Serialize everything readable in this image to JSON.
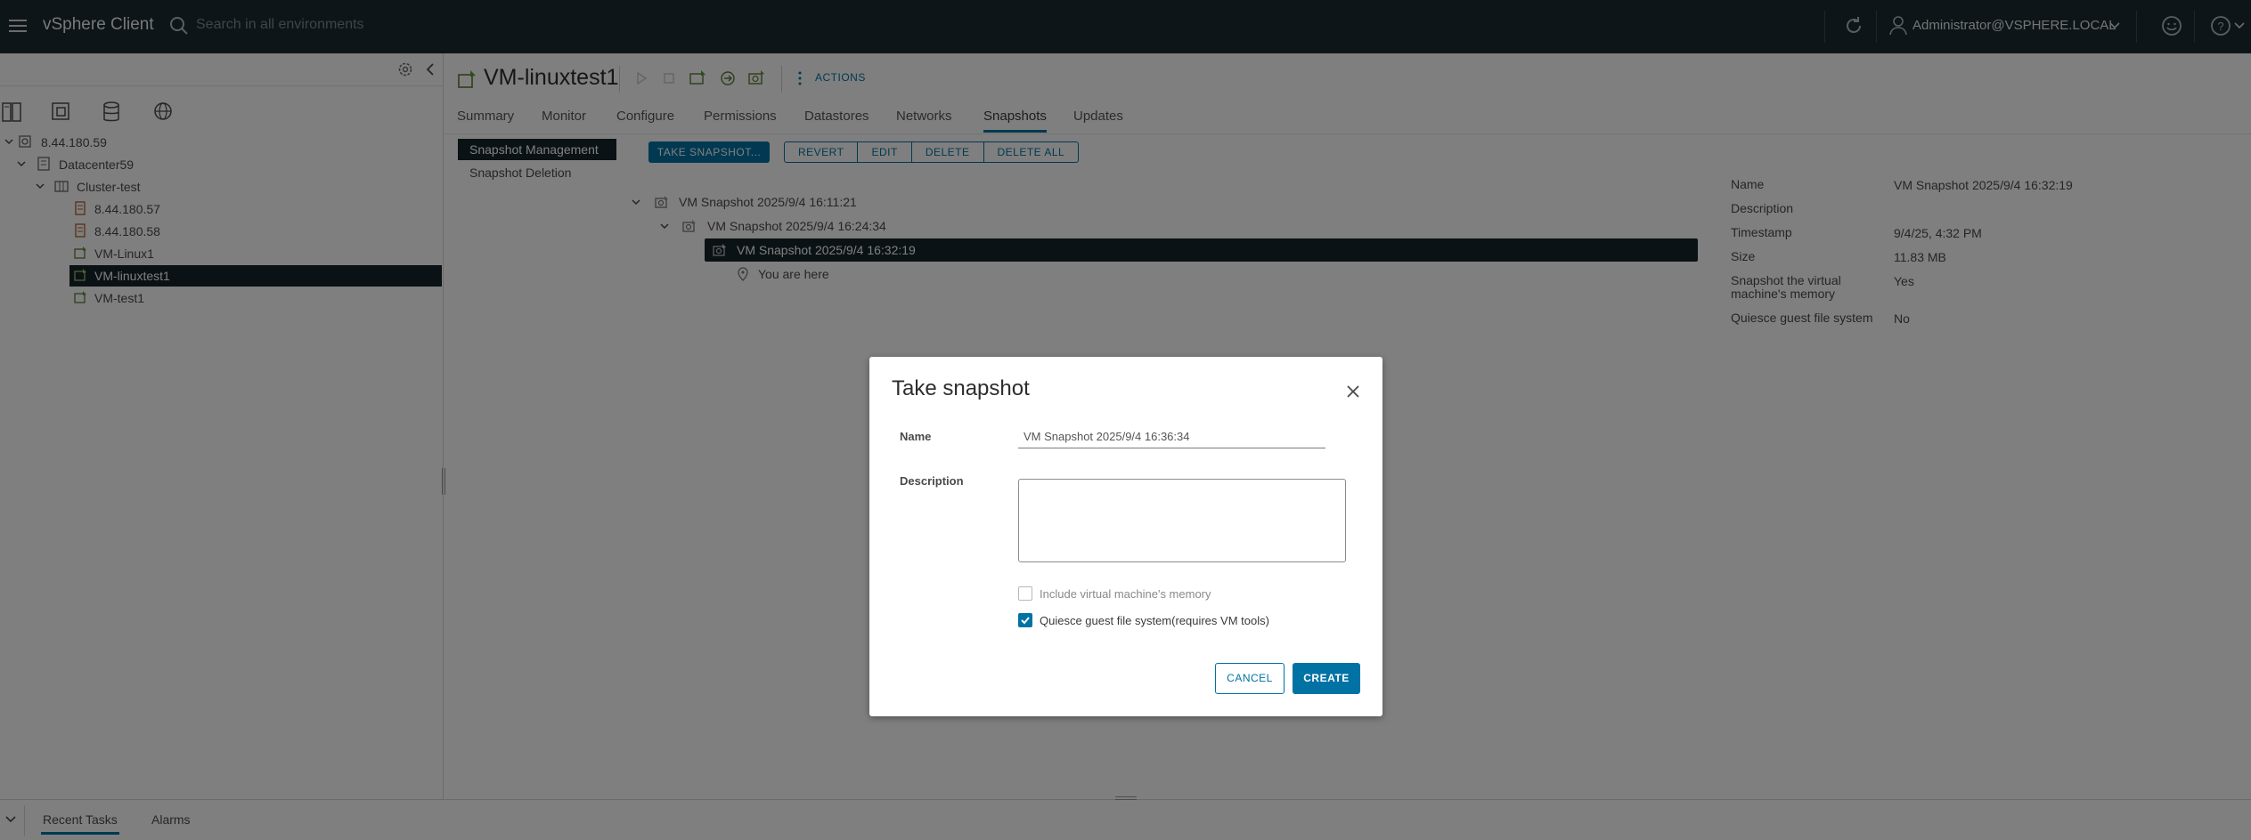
{
  "header": {
    "brand": "vSphere Client",
    "search_placeholder": "Search in all environments",
    "user": "Administrator@VSPHERE.LOCAL"
  },
  "tree": [
    {
      "label": "8.44.180.59",
      "icon": "vcenter-icon"
    },
    {
      "label": "Datacenter59",
      "icon": "datacenter-icon"
    },
    {
      "label": "Cluster-test",
      "icon": "cluster-icon"
    },
    {
      "label": "8.44.180.57",
      "icon": "host-icon"
    },
    {
      "label": "8.44.180.58",
      "icon": "host-icon"
    },
    {
      "label": "VM-Linux1",
      "icon": "vm-icon"
    },
    {
      "label": "VM-linuxtest1",
      "icon": "vm-icon"
    },
    {
      "label": "VM-test1",
      "icon": "vm-icon"
    }
  ],
  "main": {
    "vm_title": "VM-linuxtest1",
    "actions_label": "ACTIONS",
    "tabs": [
      "Summary",
      "Monitor",
      "Configure",
      "Permissions",
      "Datastores",
      "Networks",
      "Snapshots",
      "Updates"
    ],
    "subnav": [
      "Snapshot Management",
      "Snapshot Deletion"
    ],
    "toolbar": {
      "take": "TAKE SNAPSHOT...",
      "revert": "REVERT",
      "edit": "EDIT",
      "delete": "DELETE",
      "delete_all": "DELETE ALL"
    },
    "snapshots": [
      "VM Snapshot 2025/9/4 16:11:21",
      "VM Snapshot 2025/9/4 16:24:34",
      "VM Snapshot 2025/9/4 16:32:19",
      "You are here"
    ],
    "details": [
      {
        "key": "Name",
        "value": "VM Snapshot 2025/9/4 16:32:19"
      },
      {
        "key": "Description",
        "value": ""
      },
      {
        "key": "Timestamp",
        "value": "9/4/25, 4:32 PM"
      },
      {
        "key": "Size",
        "value": "11.83 MB"
      },
      {
        "key": "Snapshot the virtual machine's memory",
        "value": "Yes"
      },
      {
        "key": "Quiesce guest file system",
        "value": "No"
      }
    ]
  },
  "bottom": {
    "tabs": [
      "Recent Tasks",
      "Alarms"
    ]
  },
  "modal": {
    "title": "Take snapshot",
    "name_label": "Name",
    "name_value": "VM Snapshot 2025/9/4 16:36:34",
    "description_label": "Description",
    "memory_label": "Include virtual machine's memory",
    "quiesce_label": "Quiesce guest file system(requires VM tools)",
    "memory_checked": false,
    "quiesce_checked": true,
    "cancel": "CANCEL",
    "create": "CREATE"
  },
  "colors": {
    "header_bg": "#1b2a32",
    "accent": "#0072a3",
    "selected_bg": "#17242b"
  }
}
